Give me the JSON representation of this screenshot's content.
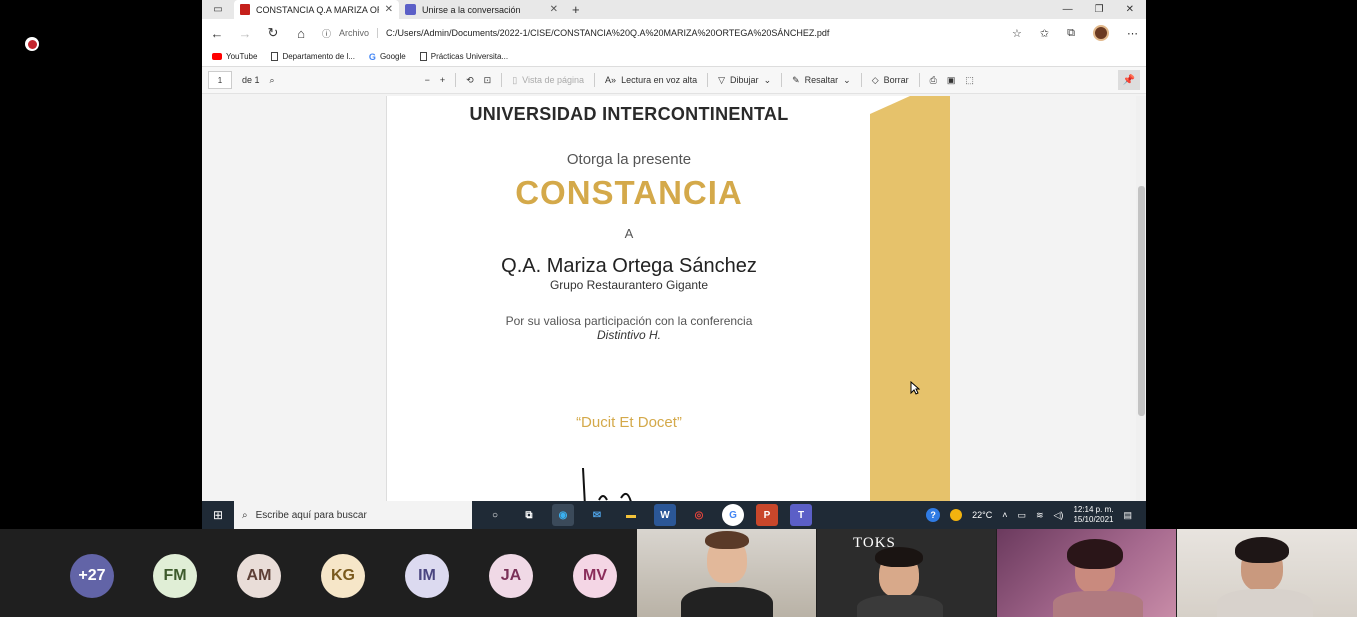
{
  "browser": {
    "tabs": [
      {
        "label": "CONSTANCIA Q.A MARIZA ORTE",
        "active": true,
        "icon": "pdf-icon"
      },
      {
        "label": "Unirse a la conversación",
        "active": false,
        "icon": "teams-icon"
      }
    ],
    "address": {
      "scheme_label": "Archivo",
      "url": "C:/Users/Admin/Documents/2022-1/CISE/CONSTANCIA%20Q.A%20MARIZA%20ORTEGA%20SÁNCHEZ.pdf"
    },
    "bookmarks": [
      {
        "label": "YouTube",
        "icon": "youtube-icon"
      },
      {
        "label": "Departamento de l...",
        "icon": "page-icon"
      },
      {
        "label": "Google",
        "icon": "google-icon"
      },
      {
        "label": "Prácticas Universita...",
        "icon": "page-icon"
      }
    ]
  },
  "pdf_toolbar": {
    "page_current": "1",
    "page_total": "de 1",
    "page_view": "Vista de página",
    "read_aloud": "Lectura en voz alta",
    "draw": "Dibujar",
    "highlight": "Resaltar",
    "erase": "Borrar"
  },
  "certificate": {
    "university": "UNIVERSIDAD INTERCONTINENTAL",
    "otorga": "Otorga la presente",
    "title": "CONSTANCIA",
    "a": "A",
    "recipient": "Q.A. Mariza Ortega Sánchez",
    "group": "Grupo Restaurantero Gigante",
    "reason": "Por su valiosa participación con la conferencia",
    "conference": "Distintivo H.",
    "motto": "“Ducit Et Docet”",
    "accent_color": "#d4a94a",
    "band_color": "#e6c26b"
  },
  "taskbar": {
    "search_placeholder": "Escribe aquí para buscar",
    "temperature": "22°C",
    "time": "12:14 p. m.",
    "date": "15/10/2021"
  },
  "participants": {
    "avatars": [
      {
        "initials": "+27",
        "bg": "#6264a7",
        "fg": "#ffffff"
      },
      {
        "initials": "FM",
        "bg": "#e0eed6",
        "fg": "#3d5a2c"
      },
      {
        "initials": "AM",
        "bg": "#e9ddd8",
        "fg": "#5d4037"
      },
      {
        "initials": "KG",
        "bg": "#f6e6c8",
        "fg": "#7a5a1e"
      },
      {
        "initials": "IM",
        "bg": "#dcdaf0",
        "fg": "#4a4580"
      },
      {
        "initials": "JA",
        "bg": "#f0d9e6",
        "fg": "#7a3158"
      },
      {
        "initials": "MV",
        "bg": "#f4d6e5",
        "fg": "#8a2d5a"
      }
    ],
    "video_logo": "TOKS"
  }
}
